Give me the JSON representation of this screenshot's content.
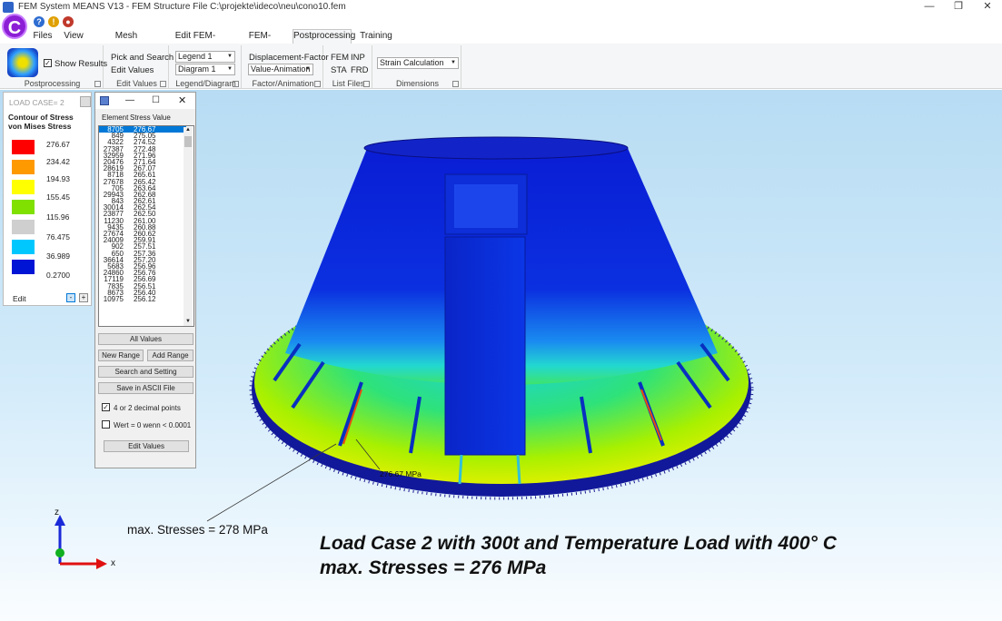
{
  "window": {
    "title": "FEM System MEANS V13 - FEM Structure File C:\\projekte\\ideco\\neu\\cono10.fem",
    "minimize": "—",
    "restore": "❐",
    "close": "✕"
  },
  "logo": {
    "letter": "C"
  },
  "quick_access": [
    {
      "name": "help-icon",
      "glyph": "?",
      "color": "#2e6dd1"
    },
    {
      "name": "tip-icon",
      "glyph": "!",
      "color": "#e0a000"
    },
    {
      "name": "record-icon",
      "glyph": "●",
      "color": "#c0392b"
    }
  ],
  "menu_tabs": [
    "Files",
    "View",
    "Mesh Generation",
    "Edit FEM-Project",
    "FEM-Analysis",
    "Postprocessing",
    "Training"
  ],
  "active_tab": "Postprocessing",
  "ribbon": {
    "show_results": "Show Results",
    "pick_search": "Pick and Search",
    "edit_values": "Edit Values",
    "legend_combo": "Legend 1",
    "diagram_combo": "Diagram 1",
    "displacement_factor": "Displacement-Factor",
    "value_animation": "Value-Animation",
    "fem": "FEM",
    "inp": "INP",
    "sta": "STA",
    "frd": "FRD",
    "strain_calc": "Strain Calculation from",
    "groups": [
      "Postprocessing",
      "Edit Values",
      "Legend/Diagram",
      "Factor/Animation",
      "List Files",
      "Dimensions"
    ]
  },
  "legend": {
    "load_case_label": "LOAD CASE=",
    "load_case_value": "2",
    "title1": "Contour of Stress",
    "title2": "von Mises Stress",
    "entries": [
      {
        "color": "#ff0000",
        "value": "276.67"
      },
      {
        "color": "#ff9900",
        "value": "234.42"
      },
      {
        "color": "#ffff00",
        "value": "194.93"
      },
      {
        "color": "#80e000",
        "value": "155.45"
      },
      {
        "color": "#cfcfcf",
        "value": "115.96"
      },
      {
        "color": "#00c8ff",
        "value": "76.475"
      },
      {
        "color": "#0014d6",
        "value": "36.989"
      },
      {
        "color": "",
        "value": "0.2700"
      }
    ],
    "edit": "Edit",
    "minus": "-",
    "plus": "+"
  },
  "element_window": {
    "col_element": "Element",
    "col_stress": "Stress Value",
    "rows": [
      [
        "8705",
        "276.67"
      ],
      [
        "849",
        "275.05"
      ],
      [
        "4322",
        "274.52"
      ],
      [
        "27387",
        "272.48"
      ],
      [
        "32959",
        "271.96"
      ],
      [
        "20476",
        "271.64"
      ],
      [
        "28619",
        "267.07"
      ],
      [
        "8718",
        "265.61"
      ],
      [
        "27678",
        "265.42"
      ],
      [
        "705",
        "263.64"
      ],
      [
        "29943",
        "262.68"
      ],
      [
        "843",
        "262.61"
      ],
      [
        "30014",
        "262.54"
      ],
      [
        "23877",
        "262.50"
      ],
      [
        "11230",
        "261.00"
      ],
      [
        "9435",
        "260.88"
      ],
      [
        "27674",
        "260.62"
      ],
      [
        "24009",
        "259.91"
      ],
      [
        "902",
        "257.51"
      ],
      [
        "650",
        "257.36"
      ],
      [
        "36614",
        "257.20"
      ],
      [
        "5683",
        "256.96"
      ],
      [
        "24860",
        "256.76"
      ],
      [
        "17119",
        "256.69"
      ],
      [
        "7835",
        "256.51"
      ],
      [
        "8673",
        "256.40"
      ],
      [
        "10975",
        "256.12"
      ]
    ],
    "all_values": "All Values",
    "new_range": "New Range",
    "add_range": "Add Range",
    "search_setting": "Search and Setting",
    "save_ascii": "Save in ASCII File",
    "decimal_label": "4 or 2 decimal points",
    "wert_label": "Wert = 0 wenn < 0.0001",
    "edit_values_btn": "Edit Values"
  },
  "viewport": {
    "peak_label": "276.67 MPa",
    "max_stress_note": "max. Stresses = 278 MPa",
    "axis_z": "z",
    "axis_x": "x",
    "caption_line1": "Load Case 2 with 300t and Temperature Load with 400° C",
    "caption_line2": "max. Stresses = 276 MPa"
  }
}
